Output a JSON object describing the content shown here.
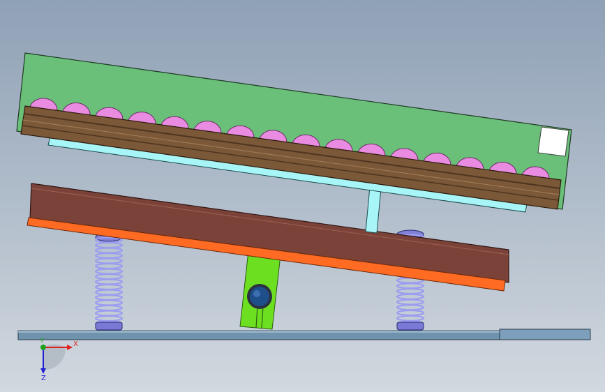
{
  "viewport": {
    "background_top": "#8fa1b6",
    "background_bottom": "#d2d8df"
  },
  "colors": {
    "top_plate": "#6abf79",
    "roller": "#e98be0",
    "rail": "#7a5838",
    "rail_dark": "#4e3520",
    "support_bar": "#a8f5f7",
    "middle_plate": "#7a4238",
    "orange_strip": "#ff6b23",
    "hinge_block": "#6ce020",
    "pivot_pin": "#1f4f8a",
    "spring": "#9c9cf0",
    "base_plate": "#6f93ad",
    "base_end": "#7e9fbb",
    "white_block": "#ffffff"
  },
  "model": {
    "roller_count": 16,
    "spring_count": 2
  },
  "triad": {
    "x_label": "X",
    "y_label": "Y",
    "z_label": "Z",
    "x_color": "#e02020",
    "y_color": "#20a020",
    "z_color": "#2020d0"
  }
}
